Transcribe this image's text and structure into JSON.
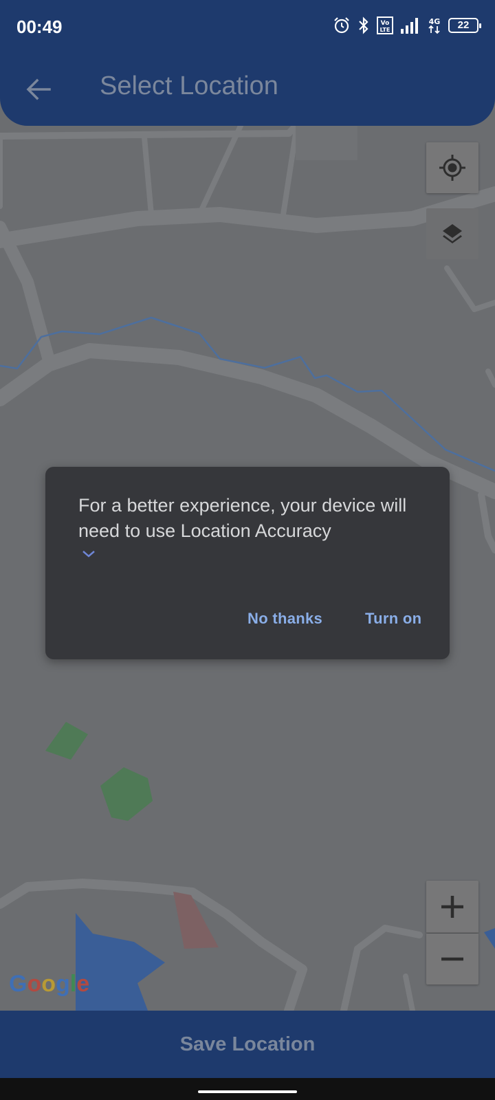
{
  "status_bar": {
    "time": "00:49",
    "battery": "22",
    "icons": [
      "alarm-icon",
      "bluetooth-icon",
      "volte-icon",
      "signal-icon",
      "4g-icon",
      "battery-icon"
    ]
  },
  "appbar": {
    "title": "Select Location",
    "back_icon": "arrow-back-icon"
  },
  "map": {
    "controls": [
      "my-location-icon",
      "layers-icon",
      "zoom-in-icon",
      "zoom-out-icon"
    ],
    "attribution": [
      "G",
      "o",
      "o",
      "g",
      "l",
      "e"
    ],
    "attribution_colors": [
      "#4285F4",
      "#EA4335",
      "#FBBC05",
      "#4285F4",
      "#34A853",
      "#EA4335"
    ]
  },
  "dialog": {
    "message": "For a better experience, your device will need to use Location Accuracy",
    "expand_icon": "chevron-down-icon",
    "no_thanks": "No thanks",
    "turn_on": "Turn on"
  },
  "footer": {
    "save_label": "Save Location"
  },
  "colors": {
    "primary": "#1e3a6d",
    "dialog_bg": "#36373b",
    "dialog_action": "#8aaee8",
    "map_scrim": "#6b6d70"
  }
}
